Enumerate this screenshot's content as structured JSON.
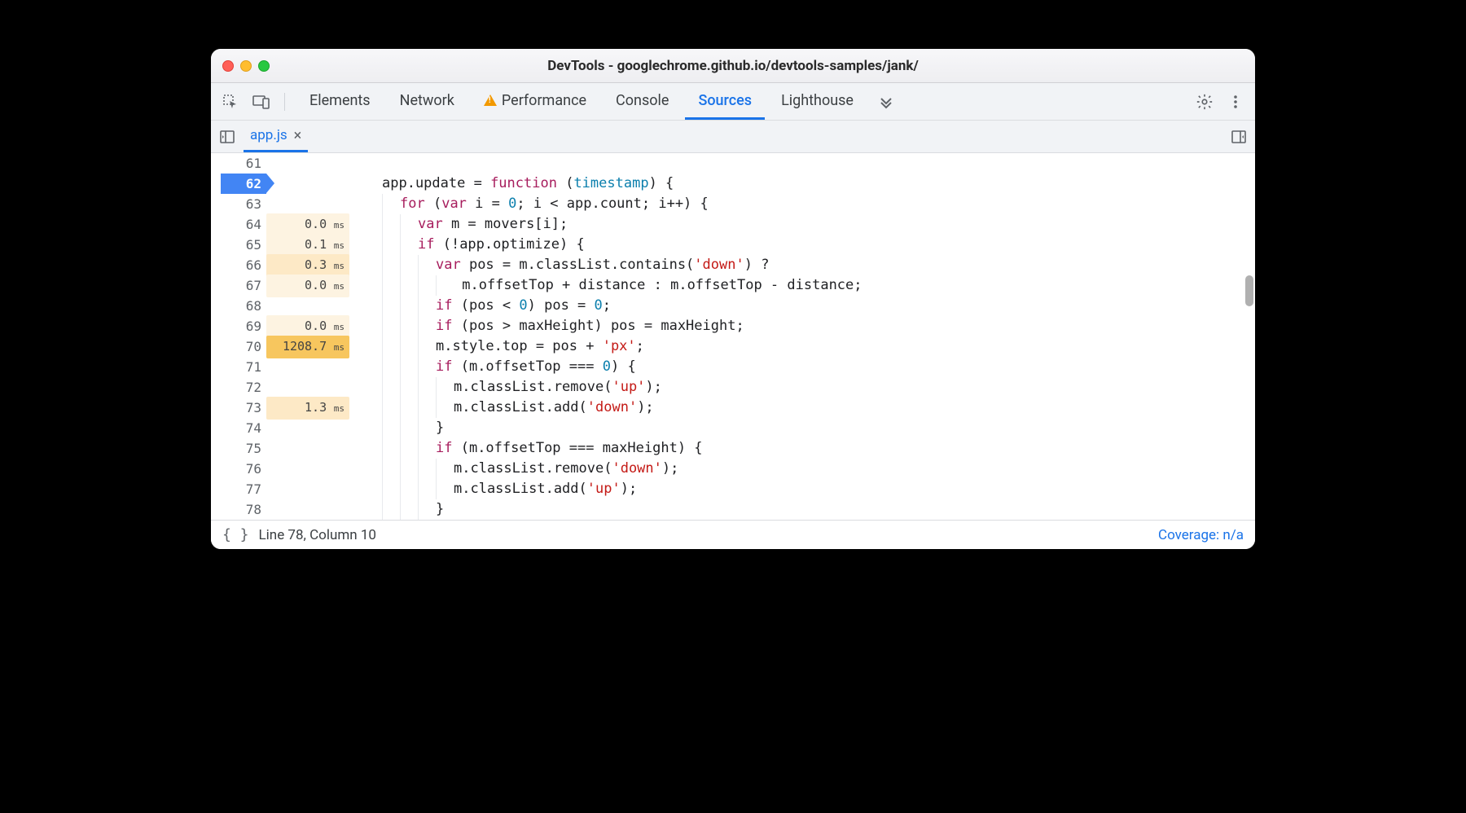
{
  "window": {
    "title": "DevTools - googlechrome.github.io/devtools-samples/jank/"
  },
  "toolbar": {
    "tabs": [
      {
        "label": "Elements",
        "active": false,
        "warn": false
      },
      {
        "label": "Network",
        "active": false,
        "warn": false
      },
      {
        "label": "Performance",
        "active": false,
        "warn": true
      },
      {
        "label": "Console",
        "active": false,
        "warn": false
      },
      {
        "label": "Sources",
        "active": true,
        "warn": false
      },
      {
        "label": "Lighthouse",
        "active": false,
        "warn": false
      }
    ]
  },
  "file_tab": {
    "name": "app.js"
  },
  "editor": {
    "lines": [
      {
        "n": 61,
        "timing": null,
        "heat": 0,
        "highlight": false,
        "indent": 0,
        "tokens": []
      },
      {
        "n": 62,
        "timing": null,
        "heat": 0,
        "highlight": true,
        "indent": 0,
        "tokens": [
          {
            "t": "app.update = ",
            "c": "default"
          },
          {
            "t": "function",
            "c": "kw"
          },
          {
            "t": " (",
            "c": "default"
          },
          {
            "t": "timestamp",
            "c": "param"
          },
          {
            "t": ") {",
            "c": "default"
          }
        ]
      },
      {
        "n": 63,
        "timing": null,
        "heat": 0,
        "highlight": false,
        "indent": 1,
        "tokens": [
          {
            "t": "for",
            "c": "kw"
          },
          {
            "t": " (",
            "c": "default"
          },
          {
            "t": "var",
            "c": "kw"
          },
          {
            "t": " i = ",
            "c": "default"
          },
          {
            "t": "0",
            "c": "num"
          },
          {
            "t": "; i < app.count; i++) {",
            "c": "default"
          }
        ]
      },
      {
        "n": 64,
        "timing": "0.0",
        "heat": 1,
        "highlight": false,
        "indent": 2,
        "tokens": [
          {
            "t": "var",
            "c": "kw"
          },
          {
            "t": " m = movers[i];",
            "c": "default"
          }
        ]
      },
      {
        "n": 65,
        "timing": "0.1",
        "heat": 1,
        "highlight": false,
        "indent": 2,
        "tokens": [
          {
            "t": "if",
            "c": "kw"
          },
          {
            "t": " (!app.optimize) {",
            "c": "default"
          }
        ]
      },
      {
        "n": 66,
        "timing": "0.3",
        "heat": 2,
        "highlight": false,
        "indent": 3,
        "tokens": [
          {
            "t": "var",
            "c": "kw"
          },
          {
            "t": " pos = m.classList.contains(",
            "c": "default"
          },
          {
            "t": "'down'",
            "c": "str"
          },
          {
            "t": ") ?",
            "c": "default"
          }
        ]
      },
      {
        "n": 67,
        "timing": "0.0",
        "heat": 1,
        "highlight": false,
        "indent": 4,
        "tokens": [
          {
            "t": " m.offsetTop + distance : m.offsetTop - distance;",
            "c": "default"
          }
        ]
      },
      {
        "n": 68,
        "timing": null,
        "heat": 0,
        "highlight": false,
        "indent": 3,
        "tokens": [
          {
            "t": "if",
            "c": "kw"
          },
          {
            "t": " (pos < ",
            "c": "default"
          },
          {
            "t": "0",
            "c": "num"
          },
          {
            "t": ") pos = ",
            "c": "default"
          },
          {
            "t": "0",
            "c": "num"
          },
          {
            "t": ";",
            "c": "default"
          }
        ]
      },
      {
        "n": 69,
        "timing": "0.0",
        "heat": 1,
        "highlight": false,
        "indent": 3,
        "tokens": [
          {
            "t": "if",
            "c": "kw"
          },
          {
            "t": " (pos > maxHeight) pos = maxHeight;",
            "c": "default"
          }
        ]
      },
      {
        "n": 70,
        "timing": "1208.7",
        "heat": 3,
        "highlight": false,
        "indent": 3,
        "tokens": [
          {
            "t": "m.style.top = pos + ",
            "c": "default"
          },
          {
            "t": "'px'",
            "c": "str"
          },
          {
            "t": ";",
            "c": "default"
          }
        ]
      },
      {
        "n": 71,
        "timing": null,
        "heat": 0,
        "highlight": false,
        "indent": 3,
        "tokens": [
          {
            "t": "if",
            "c": "kw"
          },
          {
            "t": " (m.offsetTop === ",
            "c": "default"
          },
          {
            "t": "0",
            "c": "num"
          },
          {
            "t": ") {",
            "c": "default"
          }
        ]
      },
      {
        "n": 72,
        "timing": null,
        "heat": 0,
        "highlight": false,
        "indent": 4,
        "tokens": [
          {
            "t": "m.classList.remove(",
            "c": "default"
          },
          {
            "t": "'up'",
            "c": "str"
          },
          {
            "t": ");",
            "c": "default"
          }
        ]
      },
      {
        "n": 73,
        "timing": "1.3",
        "heat": 2,
        "highlight": false,
        "indent": 4,
        "tokens": [
          {
            "t": "m.classList.add(",
            "c": "default"
          },
          {
            "t": "'down'",
            "c": "str"
          },
          {
            "t": ");",
            "c": "default"
          }
        ]
      },
      {
        "n": 74,
        "timing": null,
        "heat": 0,
        "highlight": false,
        "indent": 3,
        "tokens": [
          {
            "t": "}",
            "c": "default"
          }
        ]
      },
      {
        "n": 75,
        "timing": null,
        "heat": 0,
        "highlight": false,
        "indent": 3,
        "tokens": [
          {
            "t": "if",
            "c": "kw"
          },
          {
            "t": " (m.offsetTop === maxHeight) {",
            "c": "default"
          }
        ]
      },
      {
        "n": 76,
        "timing": null,
        "heat": 0,
        "highlight": false,
        "indent": 4,
        "tokens": [
          {
            "t": "m.classList.remove(",
            "c": "default"
          },
          {
            "t": "'down'",
            "c": "str"
          },
          {
            "t": ");",
            "c": "default"
          }
        ]
      },
      {
        "n": 77,
        "timing": null,
        "heat": 0,
        "highlight": false,
        "indent": 4,
        "tokens": [
          {
            "t": "m.classList.add(",
            "c": "default"
          },
          {
            "t": "'up'",
            "c": "str"
          },
          {
            "t": ");",
            "c": "default"
          }
        ]
      },
      {
        "n": 78,
        "timing": null,
        "heat": 0,
        "highlight": false,
        "indent": 3,
        "tokens": [
          {
            "t": "}",
            "c": "default"
          }
        ]
      }
    ]
  },
  "statusbar": {
    "position": "Line 78, Column 10",
    "coverage": "Coverage: n/a"
  }
}
